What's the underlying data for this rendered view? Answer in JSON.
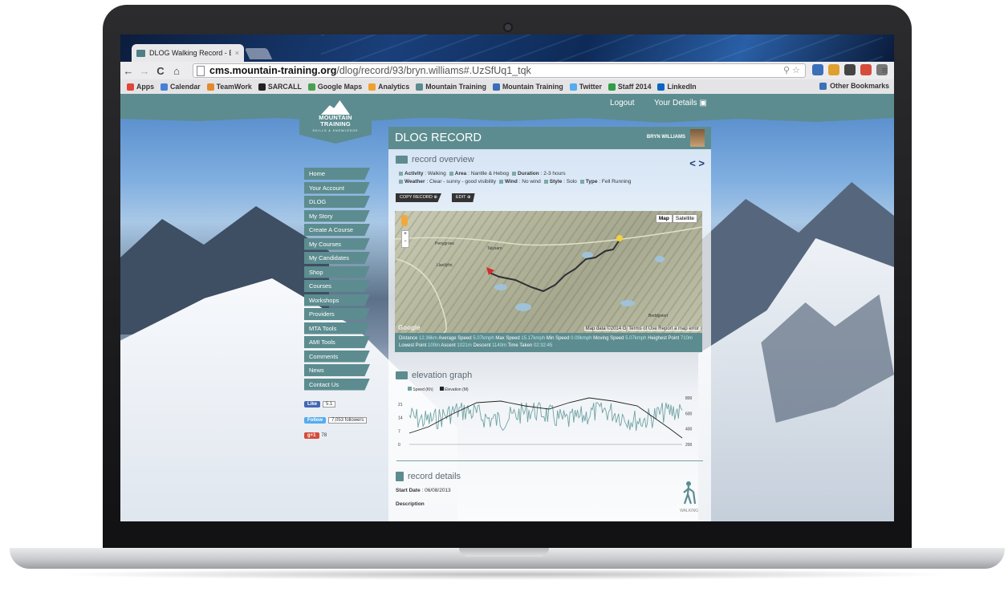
{
  "browser": {
    "tab_title": "DLOG Walking Record - B",
    "tab_close": "×",
    "nav": {
      "back": "←",
      "forward": "→",
      "reload": "C",
      "home": "⌂"
    },
    "url_host": "cms.mountain-training.org",
    "url_path": "/dlog/record/93/bryn.williams#.UzSfUq1_tqk",
    "url_right_icons": "⚲ ☆",
    "bookmarks": [
      {
        "label": "Apps",
        "color": "#e3443a"
      },
      {
        "label": "Calendar",
        "color": "#4a7fd6"
      },
      {
        "label": "TeamWork",
        "color": "#e38b2b"
      },
      {
        "label": "SARCALL",
        "color": "#222222"
      },
      {
        "label": "Google Maps",
        "color": "#4aa052"
      },
      {
        "label": "Analytics",
        "color": "#f0a030"
      },
      {
        "label": "Mountain Training",
        "color": "#5c8c8f"
      },
      {
        "label": "Mountain Training",
        "color": "#3b6fb8"
      },
      {
        "label": "Twitter",
        "color": "#55acee"
      },
      {
        "label": "Staff 2014",
        "color": "#2f9e44"
      },
      {
        "label": "LinkedIn",
        "color": "#0a66c2"
      }
    ],
    "other_bookmarks": "Other Bookmarks",
    "extensions": [
      "#3b6fb8",
      "#e0a030",
      "#444444",
      "#d54c3c",
      "#777777"
    ]
  },
  "site": {
    "logout": "Logout",
    "your_details": "Your Details",
    "logo_line1": "MOUNTAIN",
    "logo_line2": "TRAINING",
    "logo_sub": "SKILLS & KNOWLEDGE",
    "nav": [
      "Home",
      "Your Account",
      "DLOG",
      "My Story",
      "Create A Course",
      "My Courses",
      "My Candidates",
      "Shop",
      "Courses",
      "Workshops",
      "Providers",
      "MTA Tools",
      "AMI Tools",
      "Comments",
      "News",
      "Contact Us"
    ],
    "social": {
      "like_label": "Like",
      "like_count": "5.1",
      "follow_label": "Follow",
      "follow_count": "7,053 followers",
      "gplus_label": "g+1",
      "gplus_count": "78"
    }
  },
  "record": {
    "title": "DLOG RECORD",
    "user": "BRYN WILLIAMS",
    "overview_heading": "record overview",
    "prev": "<",
    "next": ">",
    "meta1": [
      {
        "k": "Activity",
        "v": "Walking"
      },
      {
        "k": "Area",
        "v": "Nantlle & Hebog"
      },
      {
        "k": "Duration",
        "v": "2-3 hours"
      }
    ],
    "meta2": [
      {
        "k": "Weather",
        "v": "Clear - sunny - good visibility"
      },
      {
        "k": "Wind",
        "v": "No wind"
      },
      {
        "k": "Style",
        "v": "Solo"
      },
      {
        "k": "Type",
        "v": "Fell Running"
      }
    ],
    "copy_record": "COPY RECORD ⊕",
    "edit": "EDIT ⊕",
    "map": {
      "map_btn": "Map",
      "satellite_btn": "Satellite",
      "credit": "Map data ©2014 Gj Terms of Use  Report a map error",
      "google": "Google",
      "zoom_in": "+",
      "zoom_out": "−",
      "labels": [
        "Penygroes",
        "Talysarn",
        "Llanllyfni",
        "Beddgelert"
      ]
    },
    "stats": [
      {
        "k": "Distance",
        "v": "12.36km"
      },
      {
        "k": "Average Speed",
        "v": "5.07kmph"
      },
      {
        "k": "Max Speed",
        "v": "15.17kmph"
      },
      {
        "k": "Min Speed",
        "v": "0.09kmph"
      },
      {
        "k": "Moving Speed",
        "v": "5.07kmph"
      },
      {
        "k": "Heighest Point",
        "v": "710m"
      },
      {
        "k": "Lowest Point",
        "v": "100m"
      },
      {
        "k": "Ascent",
        "v": "1021m"
      },
      {
        "k": "Descent",
        "v": "1140m"
      },
      {
        "k": "Time Taken",
        "v": "02:32:45"
      }
    ],
    "elevation_heading": "elevation graph",
    "graph_legend": [
      "Speed (Kh)",
      "Elevation (M)"
    ],
    "graph_left_ticks": [
      "21",
      "14",
      "7",
      "0"
    ],
    "graph_right_ticks": [
      "800",
      "600",
      "400",
      "200"
    ],
    "details_heading": "record details",
    "start_date_label": "Start Date",
    "start_date": "06/08/2013",
    "description_label": "Description",
    "activity_icon_label": "WALKING"
  },
  "colors": {
    "brand_teal": "#5c8c8f",
    "nav_arrows": "#1f3f77"
  }
}
